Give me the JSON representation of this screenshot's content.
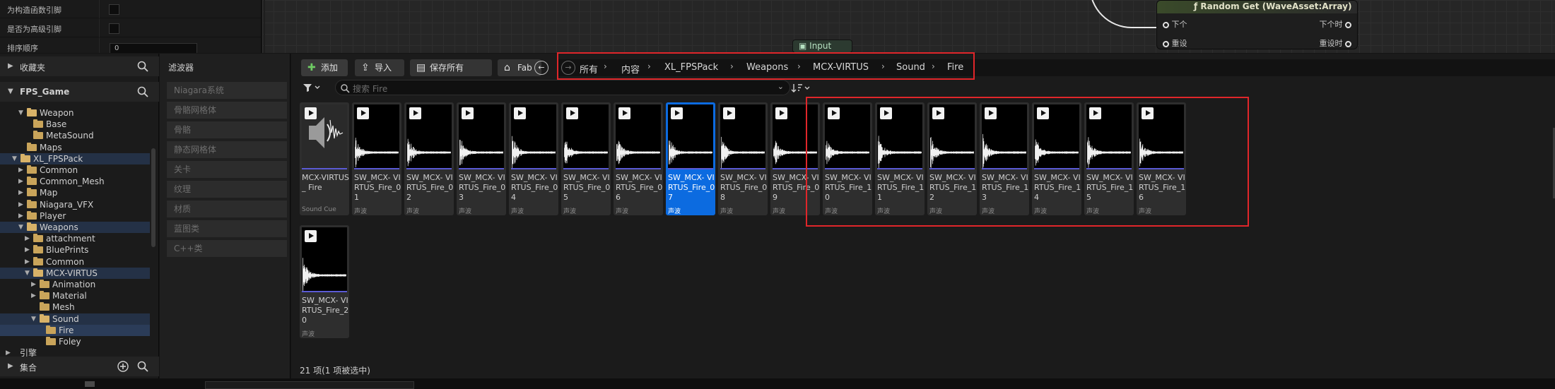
{
  "details": {
    "rows": [
      {
        "label": "为构造函数引脚",
        "kind": "checkbox"
      },
      {
        "label": "是否为高级引脚",
        "kind": "checkbox"
      },
      {
        "label": "排序顺序",
        "kind": "input",
        "value": "0"
      }
    ]
  },
  "graph": {
    "node_title": "ƒ Random Get (WaveAsset:Array)",
    "pin_left_1": "下个",
    "pin_right_1": "下个时",
    "pin_left_2": "重设",
    "pin_right_2": "重设时",
    "input_node": "Input"
  },
  "sources": {
    "favorites": "收藏夹",
    "project": "FPS_Game",
    "tree": [
      {
        "label": "Weapon",
        "depth": 2,
        "open": true
      },
      {
        "label": "Base",
        "depth": 3
      },
      {
        "label": "MetaSound",
        "depth": 3
      },
      {
        "label": "Maps",
        "depth": 2
      },
      {
        "label": "XL_FPSPack",
        "depth": 1,
        "open": true,
        "hl": true
      },
      {
        "label": "Common",
        "depth": 2,
        "caret": true
      },
      {
        "label": "Common_Mesh",
        "depth": 2,
        "caret": true
      },
      {
        "label": "Map",
        "depth": 2,
        "caret": true
      },
      {
        "label": "Niagara_VFX",
        "depth": 2,
        "caret": true
      },
      {
        "label": "Player",
        "depth": 2,
        "caret": true
      },
      {
        "label": "Weapons",
        "depth": 2,
        "open": true,
        "hl": true
      },
      {
        "label": "attachment",
        "depth": 3,
        "caret": true
      },
      {
        "label": "BluePrints",
        "depth": 3,
        "caret": true
      },
      {
        "label": "Common",
        "depth": 3,
        "caret": true
      },
      {
        "label": "MCX-VIRTUS",
        "depth": 3,
        "open": true,
        "hl": true
      },
      {
        "label": "Animation",
        "depth": 4,
        "caret": true
      },
      {
        "label": "Material",
        "depth": 4,
        "caret": true
      },
      {
        "label": "Mesh",
        "depth": 4
      },
      {
        "label": "Sound",
        "depth": 4,
        "open": true,
        "hl": true
      },
      {
        "label": "Fire",
        "depth": 5,
        "selected": true
      },
      {
        "label": "Foley",
        "depth": 5
      },
      {
        "label": "引擎",
        "depth": 0,
        "caret": true
      }
    ],
    "collections": "集合"
  },
  "filters": {
    "title": "滤波器",
    "items": [
      "Niagara系统",
      "骨骼网格体",
      "骨骼",
      "静态网格体",
      "关卡",
      "纹理",
      "材质",
      "蓝图类",
      "C++类"
    ]
  },
  "toolbar": {
    "add": "添加",
    "import": "导入",
    "save_all": "保存所有",
    "fab": "Fab"
  },
  "breadcrumb": [
    "所有",
    "内容",
    "XL_FPSPack",
    "Weapons",
    "MCX-VIRTUS",
    "Sound",
    "Fire"
  ],
  "search": {
    "placeholder": "搜索 Fire"
  },
  "assets": [
    {
      "name": "MCX-VIRTUS_ Fire",
      "type": "Sound Cue",
      "kind": "cue"
    },
    {
      "name": "SW_MCX- VIRTUS_Fire_01",
      "type": "声波"
    },
    {
      "name": "SW_MCX- VIRTUS_Fire_02",
      "type": "声波"
    },
    {
      "name": "SW_MCX- VIRTUS_Fire_03",
      "type": "声波"
    },
    {
      "name": "SW_MCX- VIRTUS_Fire_04",
      "type": "声波"
    },
    {
      "name": "SW_MCX- VIRTUS_Fire_05",
      "type": "声波"
    },
    {
      "name": "SW_MCX- VIRTUS_Fire_06",
      "type": "声波"
    },
    {
      "name": "SW_MCX- VIRTUS_Fire_07",
      "type": "声波",
      "selected": true
    },
    {
      "name": "SW_MCX- VIRTUS_Fire_08",
      "type": "声波"
    },
    {
      "name": "SW_MCX- VIRTUS_Fire_09",
      "type": "声波"
    },
    {
      "name": "SW_MCX- VIRTUS_Fire_10",
      "type": "声波"
    },
    {
      "name": "SW_MCX- VIRTUS_Fire_11",
      "type": "声波"
    },
    {
      "name": "SW_MCX- VIRTUS_Fire_12",
      "type": "声波"
    },
    {
      "name": "SW_MCX- VIRTUS_Fire_13",
      "type": "声波"
    },
    {
      "name": "SW_MCX- VIRTUS_Fire_14",
      "type": "声波"
    },
    {
      "name": "SW_MCX- VIRTUS_Fire_15",
      "type": "声波"
    },
    {
      "name": "SW_MCX- VIRTUS_Fire_16",
      "type": "声波"
    },
    {
      "name": "SW_MCX- VIRTUS_Fire_20",
      "type": "声波"
    }
  ],
  "status": {
    "count": "21 项(1 项被选中)"
  },
  "colors": {
    "selection": "#0c6be0",
    "highlight_box": "#e0262a",
    "folder": "#c9a45a"
  }
}
